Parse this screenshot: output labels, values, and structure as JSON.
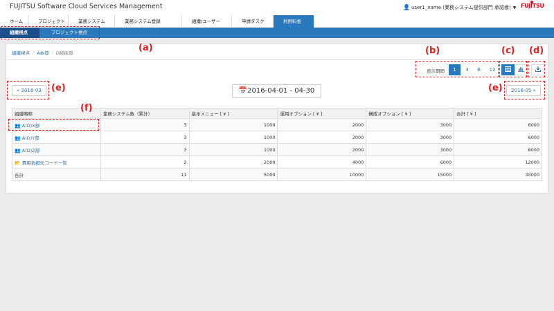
{
  "app": {
    "title": "FUJITSU Software Cloud Services Management",
    "user": "user1_name (業務システム提供部門 承認者)",
    "logo": "FUJITSU"
  },
  "nav": {
    "items": [
      "ホーム",
      "プロジェクト",
      "業務システム",
      "業務システム登録",
      "組織/ユーザー",
      "申請タスク",
      "利用料金"
    ],
    "active_index": 6
  },
  "subnav": {
    "items": [
      "組織視点",
      "プロジェクト視点"
    ],
    "active_index": 0
  },
  "breadcrumb": [
    "組織視点",
    "A本部",
    "D統括部"
  ],
  "period": {
    "label": "表示期間",
    "options": [
      "1",
      "3",
      "6",
      "12"
    ],
    "selected": "1"
  },
  "view_buttons": {
    "table_icon": "table-icon",
    "chart_icon": "bar-chart-icon",
    "download_icon": "download-icon"
  },
  "navigation": {
    "prev": "« 2016-03",
    "next": "2016-05 »",
    "range": "2016-04-01 - 04-30"
  },
  "table": {
    "headers": [
      "組織略称",
      "業務システム数（累計）",
      "基本メニュー [ ¥ ]",
      "運用オプション [ ¥ ]",
      "構成オプション [ ¥ ]",
      "合計 [ ¥ ]"
    ],
    "rows": [
      {
        "icon": "users-icon",
        "name": "A)D)X部",
        "count": "3",
        "basic": "1000",
        "ops": "2000",
        "config": "3000",
        "total": "6000"
      },
      {
        "icon": "users-icon",
        "name": "A)D)Y部",
        "count": "3",
        "basic": "1000",
        "ops": "2000",
        "config": "3000",
        "total": "6000"
      },
      {
        "icon": "users-icon",
        "name": "A)D)Z部",
        "count": "3",
        "basic": "1000",
        "ops": "2000",
        "config": "3000",
        "total": "6000"
      },
      {
        "icon": "folder-icon",
        "name": "費用負担元コード一覧",
        "count": "2",
        "basic": "2000",
        "ops": "4000",
        "config": "6000",
        "total": "12000"
      }
    ],
    "footer": {
      "name": "合計",
      "count": "11",
      "basic": "5000",
      "ops": "10000",
      "config": "15000",
      "total": "30000"
    }
  },
  "annotations": [
    "(a)",
    "(b)",
    "(c)",
    "(d)",
    "(e)",
    "(e)",
    "(f)"
  ],
  "colors": {
    "accent": "#2a79bd",
    "annotation": "#e51a1a"
  }
}
